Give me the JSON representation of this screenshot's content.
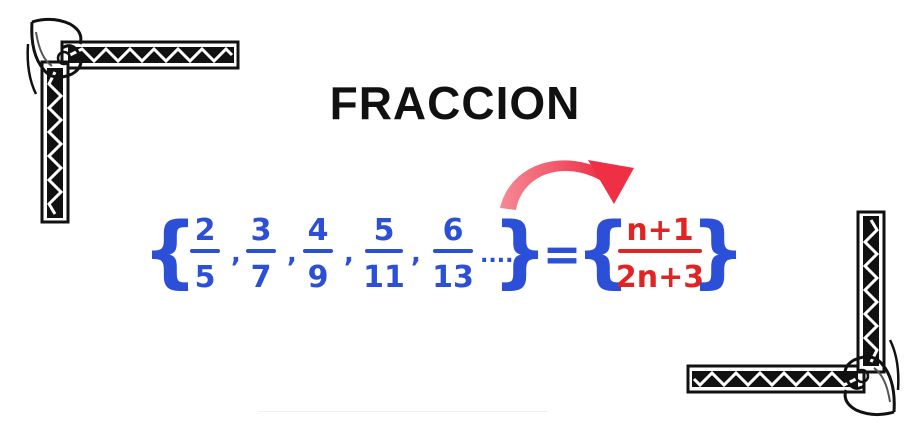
{
  "title": "FRACCION",
  "sequence": {
    "fractions": [
      {
        "num": "2",
        "den": "5"
      },
      {
        "num": "3",
        "den": "7"
      },
      {
        "num": "4",
        "den": "9"
      },
      {
        "num": "5",
        "den": "11"
      },
      {
        "num": "6",
        "den": "13"
      }
    ],
    "separator": ",",
    "ellipsis": "....",
    "open_brace": "{",
    "close_brace": "}"
  },
  "equals": "=",
  "formula": {
    "num": "n+1",
    "den": "2n+3",
    "open_brace": "{",
    "close_brace": "}"
  },
  "colors": {
    "sequence": "#2b4fd6",
    "formula": "#e02424",
    "arrow": "#f0455a",
    "title": "#111111",
    "ornament": "#111111"
  },
  "icons": {
    "arrow": "curved-arrow-icon",
    "top_left": "corner-ornament-icon",
    "bottom_right": "corner-ornament-icon"
  }
}
